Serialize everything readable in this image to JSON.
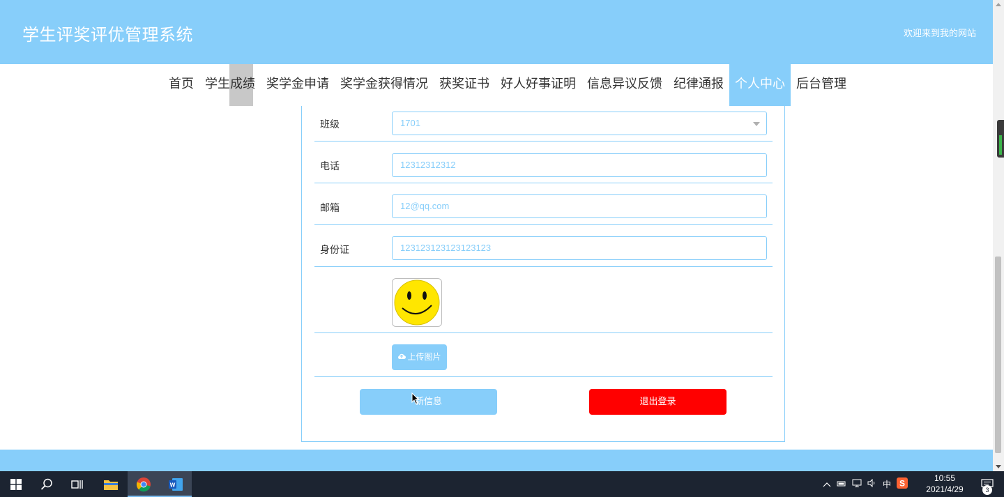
{
  "header": {
    "site_title": "学生评奖评优管理系统",
    "welcome_text": "欢迎来到我的网站"
  },
  "nav": {
    "items": [
      {
        "label": "首页"
      },
      {
        "label": "学生成绩"
      },
      {
        "label": "奖学金申请"
      },
      {
        "label": "奖学金获得情况"
      },
      {
        "label": "获奖证书"
      },
      {
        "label": "好人好事证明"
      },
      {
        "label": "信息异议反馈"
      },
      {
        "label": "纪律通报"
      },
      {
        "label": "个人中心",
        "active": true
      },
      {
        "label": "后台管理"
      }
    ]
  },
  "form": {
    "class": {
      "label": "班级",
      "value": "1701"
    },
    "phone": {
      "label": "电话",
      "value": "12312312312"
    },
    "email": {
      "label": "邮箱",
      "value": "12@qq.com"
    },
    "id_card": {
      "label": "身份证",
      "value": "123123123123123123"
    },
    "avatar": {
      "icon": "smiley-face-image"
    },
    "upload_label": "上传图片",
    "update_label": "新信息",
    "logout_label": "退出登录"
  },
  "taskbar": {
    "time": "10:55",
    "date": "2021/4/29",
    "ime": "中",
    "notification_count": "3"
  },
  "colors": {
    "accent": "#87CEFA",
    "danger": "#FF0000",
    "taskbar": "#1c2431"
  }
}
